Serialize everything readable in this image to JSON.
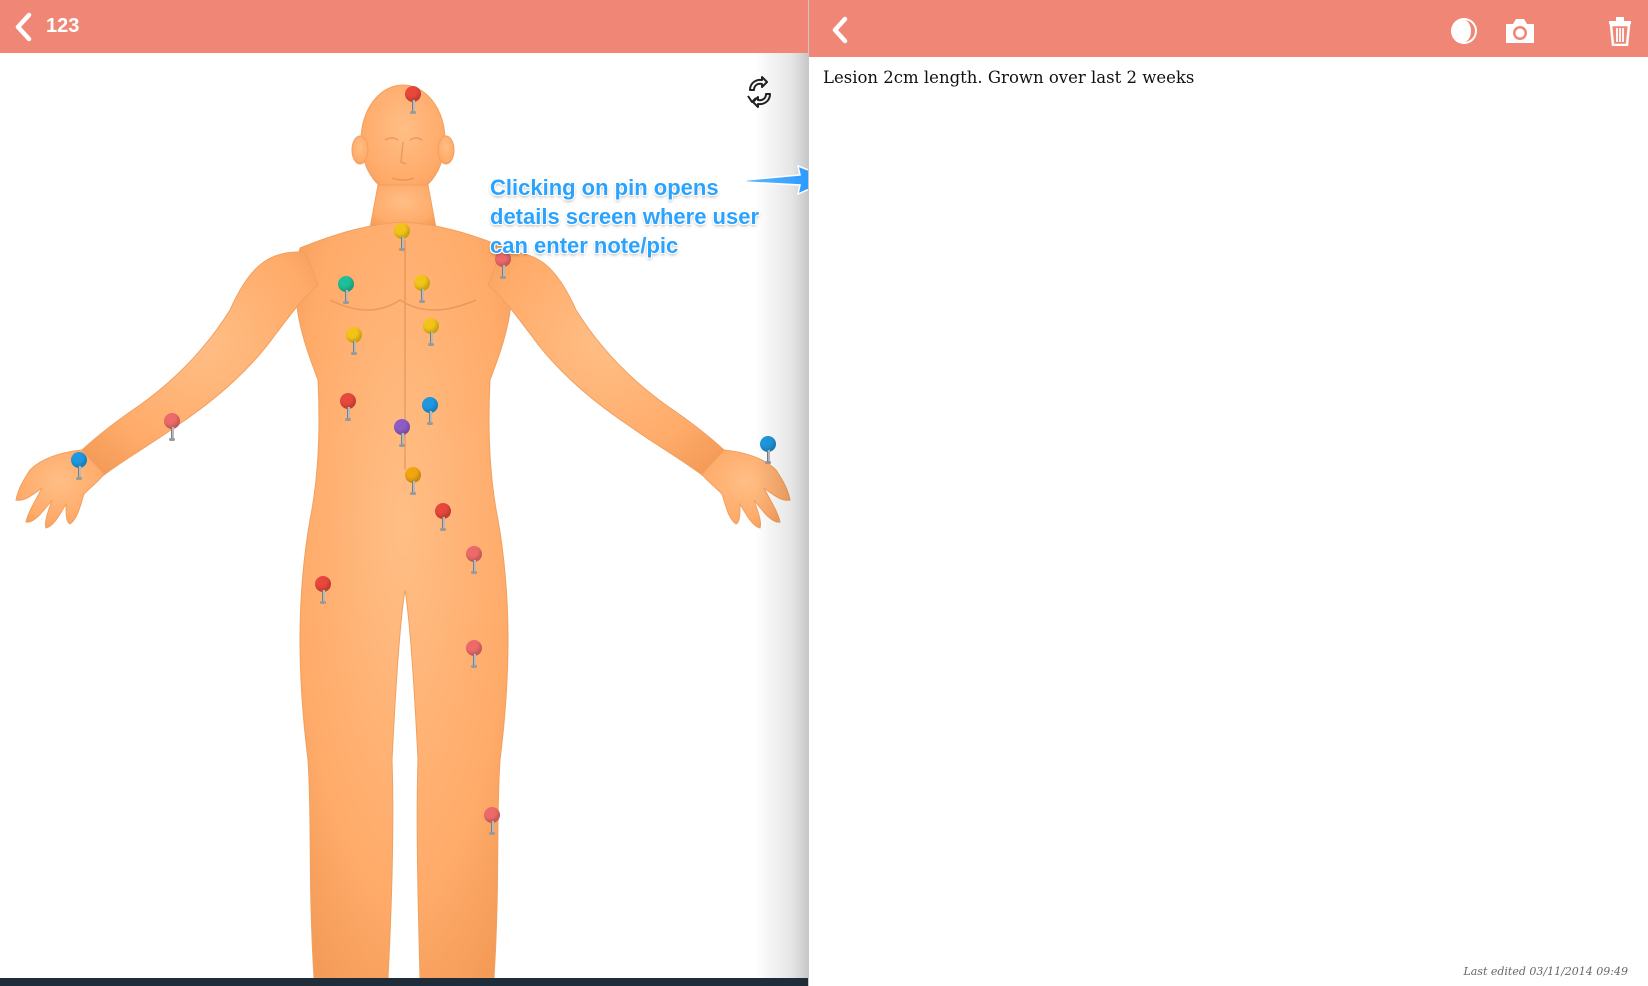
{
  "left_panel": {
    "back_icon": "chevron-left-icon",
    "title": "123",
    "rotate_icon": "rotate-icon",
    "pins": [
      {
        "id": "pin-head",
        "color": "#e8483c"
      },
      {
        "id": "pin-neck",
        "color": "#f2c318"
      },
      {
        "id": "pin-shoulder-right",
        "color": "#ee6a6a"
      },
      {
        "id": "pin-chest-left",
        "color": "#1fbf9a"
      },
      {
        "id": "pin-chest-center",
        "color": "#f2c318"
      },
      {
        "id": "pin-chest-low-left",
        "color": "#f2c318"
      },
      {
        "id": "pin-chest-low-right",
        "color": "#f2c318"
      },
      {
        "id": "pin-abdomen-left",
        "color": "#e8483c"
      },
      {
        "id": "pin-abdomen-right",
        "color": "#1f98e0"
      },
      {
        "id": "pin-navel",
        "color": "#8e5cc7"
      },
      {
        "id": "pin-lower-abdomen",
        "color": "#f2a511"
      },
      {
        "id": "pin-hip-right",
        "color": "#e8483c"
      },
      {
        "id": "pin-forearm-left",
        "color": "#ee6a6a"
      },
      {
        "id": "pin-palm-left",
        "color": "#1f98e0"
      },
      {
        "id": "pin-palm-right",
        "color": "#1f98e0"
      },
      {
        "id": "pin-thigh-right",
        "color": "#ee6a6a"
      },
      {
        "id": "pin-thigh-left",
        "color": "#e8483c"
      },
      {
        "id": "pin-knee-right",
        "color": "#ee6a6a"
      },
      {
        "id": "pin-shin-right",
        "color": "#ee6a6a"
      }
    ],
    "annotation": {
      "lines": [
        "Clicking on pin opens",
        "details screen where user",
        "can enter note/pic"
      ],
      "color": "#2aa3ff"
    }
  },
  "right_panel": {
    "back_icon": "chevron-left-icon",
    "toolbar_icons": [
      "contrast-icon",
      "camera-icon",
      "trash-icon"
    ],
    "note": "Lesion 2cm length. Grown over last 2 weeks",
    "last_edited": "Last edited 03/11/2014 09:49"
  },
  "colors": {
    "header": "#f08675",
    "skin": "#ffb173"
  }
}
